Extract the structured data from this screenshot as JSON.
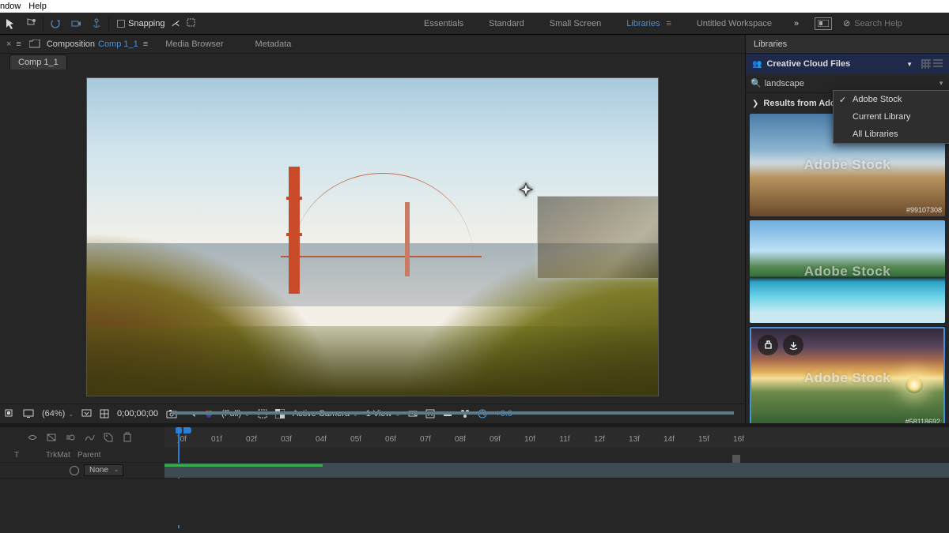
{
  "menubar": {
    "items": [
      "ndow",
      "Help"
    ]
  },
  "toolbar": {
    "snapping_label": "Snapping",
    "workspaces": [
      "Essentials",
      "Standard",
      "Small Screen",
      "Libraries",
      "Untitled Workspace"
    ],
    "active_workspace": "Libraries",
    "search_placeholder": "Search Help"
  },
  "comp_panel": {
    "composition_label": "Composition",
    "composition_name": "Comp 1_1",
    "tabs": [
      "Media Browser",
      "Metadata"
    ],
    "tab_name": "Comp 1_1"
  },
  "viewer_controls": {
    "zoom": "(64%)",
    "timecode": "0;00;00;00",
    "resolution": "(Full)",
    "camera": "Active Camera",
    "view_count": "1 View",
    "exposure": "+0.0"
  },
  "timeline": {
    "ruler": [
      ")0f",
      "01f",
      "02f",
      "03f",
      "04f",
      "05f",
      "06f",
      "07f",
      "08f",
      "09f",
      "10f",
      "11f",
      "12f",
      "13f",
      "14f",
      "15f",
      "16f"
    ],
    "columns": {
      "t": "T",
      "trkmat": "TrkMat",
      "parent": "Parent"
    },
    "parent_value": "None"
  },
  "right": {
    "panel_title": "Libraries",
    "section_title": "Creative Cloud Files",
    "search_value": "landscape",
    "results_label": "Results from Adobe",
    "dropdown": [
      "Adobe Stock",
      "Current Library",
      "All Libraries"
    ],
    "dropdown_selected": "Adobe Stock",
    "watermark": "Adobe Stock",
    "stock_ids": [
      "#99107308",
      "",
      "#58118692",
      ""
    ]
  }
}
